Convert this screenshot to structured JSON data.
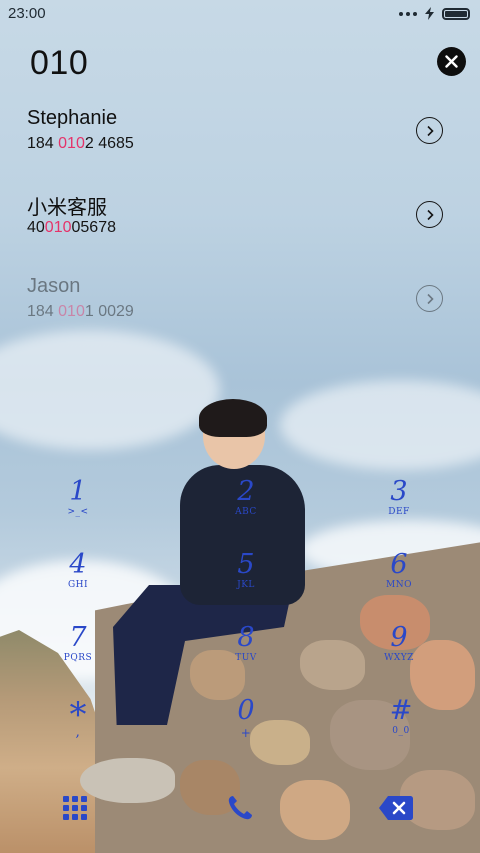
{
  "status_bar": {
    "time": "23:00"
  },
  "search": {
    "query": "010"
  },
  "results": [
    {
      "name": "Stephanie",
      "number_before": "184 ",
      "number_match": "010",
      "number_after": "2 4685"
    },
    {
      "name": "小米客服",
      "number_before": "40",
      "number_match": "010",
      "number_after": "05678"
    },
    {
      "name": "Jason",
      "number_before": "184 ",
      "number_match": "010",
      "number_after": "1 0029"
    }
  ],
  "dialpad": {
    "keys": [
      {
        "digit": "1",
        "letters": ">_<"
      },
      {
        "digit": "2",
        "letters": "ABC"
      },
      {
        "digit": "3",
        "letters": "DEF"
      },
      {
        "digit": "4",
        "letters": "GHI"
      },
      {
        "digit": "5",
        "letters": "JKL"
      },
      {
        "digit": "6",
        "letters": "MNO"
      },
      {
        "digit": "7",
        "letters": "PQRS"
      },
      {
        "digit": "8",
        "letters": "TUV"
      },
      {
        "digit": "9",
        "letters": "WXYZ"
      },
      {
        "digit": "*",
        "letters": ","
      },
      {
        "digit": "0",
        "letters": "+"
      },
      {
        "digit": "#",
        "letters": "0_0"
      }
    ]
  },
  "colors": {
    "accent": "#2a48c8",
    "match_highlight": "#e5336a"
  },
  "icons": {
    "status": [
      "more-dots-icon",
      "charging-bolt-icon",
      "battery-icon"
    ],
    "clear": "close-icon",
    "row_detail": "chevron-right-icon",
    "bottom": [
      "keypad-grid-icon",
      "phone-icon",
      "backspace-icon"
    ]
  }
}
